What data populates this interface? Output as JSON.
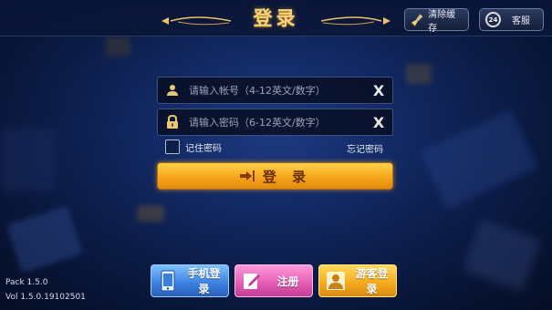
{
  "header": {
    "title": "登录",
    "clear_cache_label": "清除缓存",
    "service_label": "客服",
    "service_badge": "24"
  },
  "form": {
    "account_placeholder": "请输入帐号（4-12英文/数字）",
    "password_placeholder": "请输入密码（6-12英文/数字）",
    "clear_glyph": "X",
    "remember_label": "记住密码",
    "forgot_label": "忘记密码",
    "login_label": "登 录"
  },
  "footer": {
    "pack": "Pack 1.5.0",
    "version": "Vol 1.5.0.19102501"
  },
  "bottom_buttons": {
    "phone_login": "手机登录",
    "register": "注册",
    "guest_login": "游客登录"
  },
  "colors": {
    "title_gold": "#f5d37a",
    "login_orange": "#f7a51a",
    "phone_blue": "#3a7fe0",
    "register_pink": "#e35bb3",
    "guest_yellow": "#f5a81c"
  }
}
